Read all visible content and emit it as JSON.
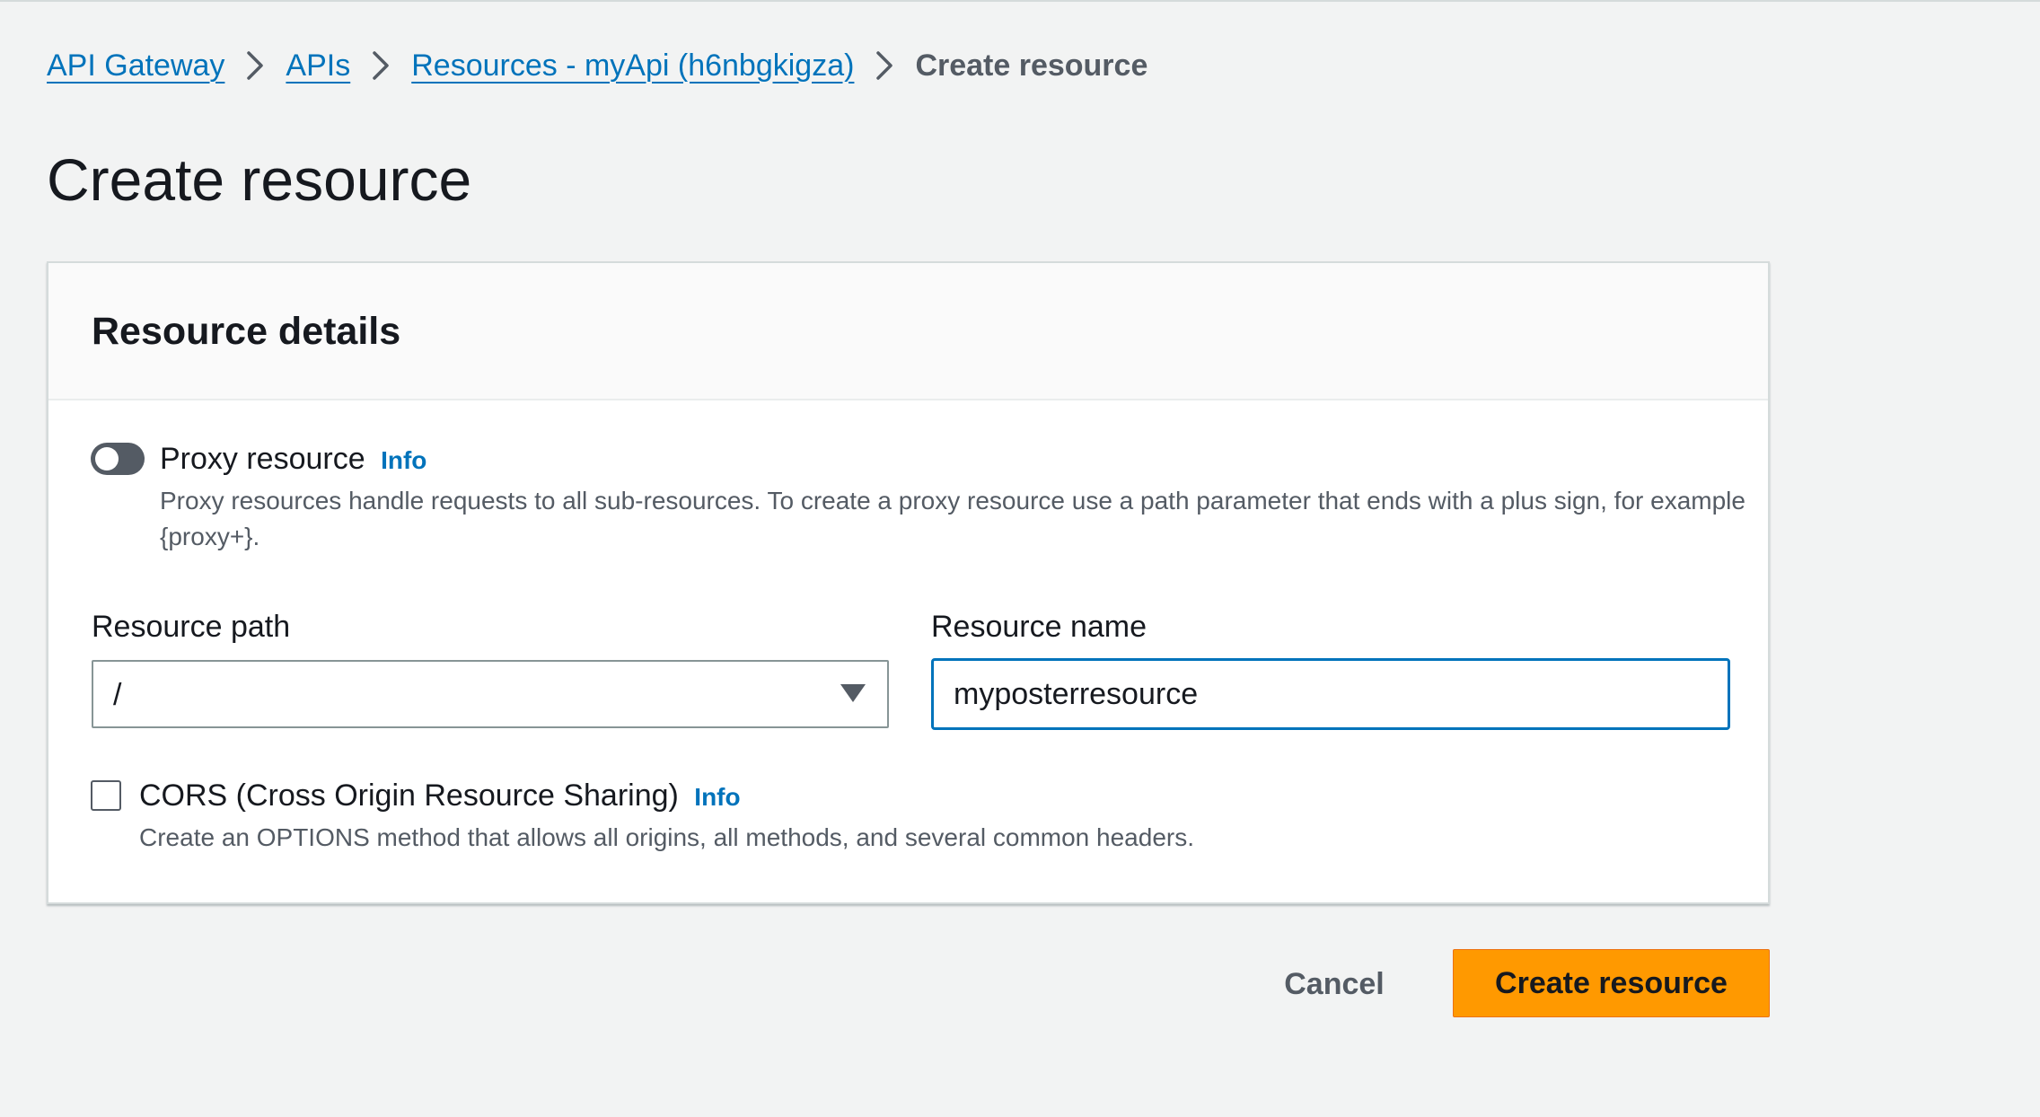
{
  "breadcrumb": {
    "items": [
      {
        "label": "API Gateway"
      },
      {
        "label": "APIs"
      },
      {
        "label": "Resources - myApi (h6nbgkigza)"
      },
      {
        "label": "Create resource"
      }
    ]
  },
  "page": {
    "title": "Create resource"
  },
  "panel": {
    "title": "Resource details",
    "proxy": {
      "label": "Proxy resource",
      "info": "Info",
      "enabled": false,
      "description": "Proxy resources handle requests to all sub-resources. To create a proxy resource use a path parameter that ends with a plus sign, for example {proxy+}."
    },
    "resource_path": {
      "label": "Resource path",
      "value": "/"
    },
    "resource_name": {
      "label": "Resource name",
      "value": "myposterresource"
    },
    "cors": {
      "label": "CORS (Cross Origin Resource Sharing)",
      "info": "Info",
      "checked": false,
      "description": "Create an OPTIONS method that allows all origins, all methods, and several common headers."
    }
  },
  "actions": {
    "cancel_label": "Cancel",
    "submit_label": "Create resource"
  },
  "colors": {
    "link": "#0073bb",
    "primary_button": "#ff9900",
    "background": "#f2f3f3",
    "input_focus_border": "#0073bb"
  },
  "icons": {
    "breadcrumb_separator": "chevron-right-icon",
    "select_caret": "caret-down-icon"
  }
}
